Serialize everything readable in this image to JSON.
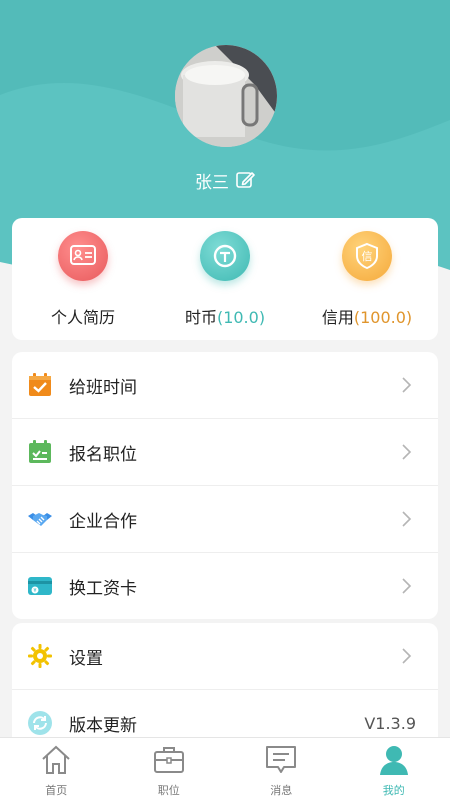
{
  "colors": {
    "header_teal": "#5cc3c1",
    "header_teal_dark": "#4db5b3",
    "accent_teal": "#3fb9b3",
    "accent_gold": "#e0952c",
    "resume_red": "#e85a5c",
    "text_dark": "#222222",
    "tab_inactive": "#777777"
  },
  "profile": {
    "avatar_icon": "avatar-photo",
    "name": "张三",
    "edit_icon": "edit-icon"
  },
  "stats": [
    {
      "icon": "resume-card-icon",
      "label": "个人简历",
      "value": ""
    },
    {
      "icon": "time-coin-icon",
      "label": "时币",
      "value": "(10.0)"
    },
    {
      "icon": "credit-shield-icon",
      "label": "信用",
      "value": "(100.0)"
    }
  ],
  "menu_primary": [
    {
      "icon": "calendar-check-icon",
      "label": "给班时间"
    },
    {
      "icon": "clipboard-signup-icon",
      "label": "报名职位"
    },
    {
      "icon": "handshake-icon",
      "label": "企业合作"
    },
    {
      "icon": "wallet-card-icon",
      "label": "换工资卡"
    }
  ],
  "menu_secondary": [
    {
      "icon": "gear-icon",
      "label": "设置",
      "value": ""
    },
    {
      "icon": "refresh-icon",
      "label": "版本更新",
      "value": "V1.3.9"
    }
  ],
  "tabbar": [
    {
      "icon": "home-icon",
      "label": "首页",
      "active": false
    },
    {
      "icon": "briefcase-icon",
      "label": "职位",
      "active": false
    },
    {
      "icon": "message-icon",
      "label": "消息",
      "active": false
    },
    {
      "icon": "person-icon",
      "label": "我的",
      "active": true
    }
  ]
}
